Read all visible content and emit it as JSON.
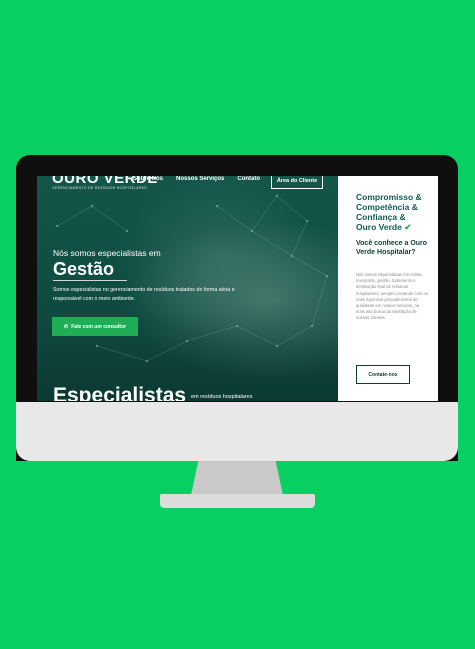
{
  "brand": {
    "logo_text": "OURO VERDE",
    "logo_subtitle": "GERENCIAMENTO DE RESÍDUOS HOSPITALARES"
  },
  "nav": {
    "items": [
      "Sobre Nós",
      "Nossos Serviços",
      "Contato"
    ],
    "client_button": "Área do Cliente"
  },
  "hero": {
    "heading_small": "Nós somos especialistas em",
    "heading_big": "Gestão",
    "description": "Somos especialistas no gerenciamento de resíduos tratados de forma séria e responsável com o meio ambiente.",
    "cta_label": "Fale com um consultor",
    "specialists_title": "Especialistas",
    "specialists_sub": "em resíduos hospitalares"
  },
  "sidebar": {
    "title_lines": [
      "Compromisso &",
      "Competência &",
      "Confiança &",
      "Ouro Verde"
    ],
    "question": "Você conhece a Ouro Verde Hospitalar?",
    "text": "Nós somos especialistas em coleta, transporte, gestão, tratamento e destinação final de resíduos hospitalares, sempre contando com os mais rigorosos procedimentos de qualidade em nossos serviços, na mais alta busca da satisfação de nossos clientes.",
    "button": "Contate-nos"
  },
  "colors": {
    "background": "#08cf62",
    "hero_dark": "#0e3f36",
    "accent_green": "#1fae55",
    "title_teal": "#0f5e54"
  }
}
